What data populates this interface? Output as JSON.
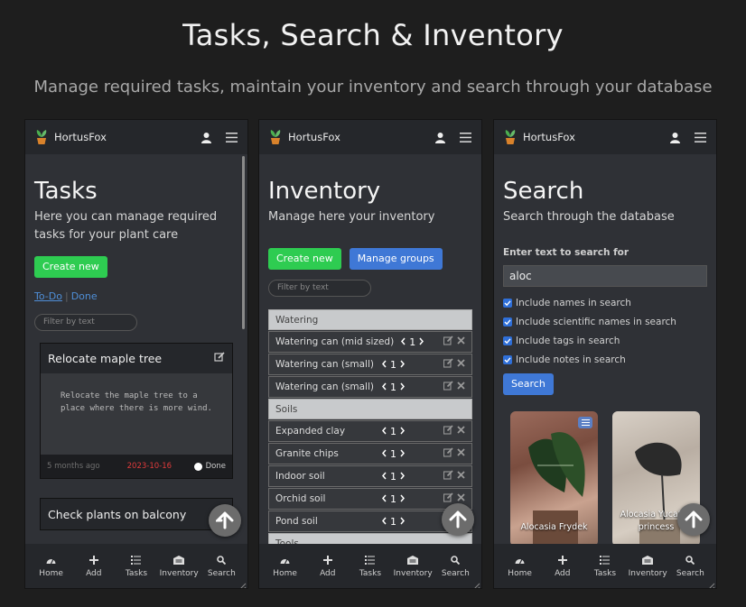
{
  "header": {
    "title": "Tasks, Search & Inventory",
    "subtitle": "Manage required tasks, maintain your inventory and search through your database"
  },
  "app": {
    "brand": "HortusFox",
    "accent": "#2ecc51",
    "link_color": "#4f8fd8"
  },
  "nav": [
    {
      "label": "Home",
      "icon": "dashboard-icon"
    },
    {
      "label": "Add",
      "icon": "plus-icon"
    },
    {
      "label": "Tasks",
      "icon": "list-icon"
    },
    {
      "label": "Inventory",
      "icon": "warehouse-icon"
    },
    {
      "label": "Search",
      "icon": "search-icon"
    }
  ],
  "tasks": {
    "title": "Tasks",
    "description": "Here you can manage required tasks for your plant care",
    "create_label": "Create new",
    "tab_todo": "To-Do",
    "tab_done": "Done",
    "filter_placeholder": "Filter by text",
    "cards": [
      {
        "title": "Relocate maple tree",
        "body": "Relocate the maple tree to a place where there is more wind.",
        "age": "5 months ago",
        "due": "2023-10-16",
        "done_label": "Done"
      },
      {
        "title": "Check plants on balcony"
      }
    ]
  },
  "inventory": {
    "title": "Inventory",
    "description": "Manage here your inventory",
    "create_label": "Create new",
    "groups_label": "Manage groups",
    "filter_placeholder": "Filter by text",
    "groups": [
      {
        "name": "Watering",
        "items": [
          {
            "name": "Watering can (mid sized)",
            "qty": "1"
          },
          {
            "name": "Watering can (small)",
            "qty": "1"
          },
          {
            "name": "Watering can (small)",
            "qty": "1"
          }
        ]
      },
      {
        "name": "Soils",
        "items": [
          {
            "name": "Expanded clay",
            "qty": "1"
          },
          {
            "name": "Granite chips",
            "qty": "1"
          },
          {
            "name": "Indoor soil",
            "qty": "1"
          },
          {
            "name": "Orchid soil",
            "qty": "1"
          },
          {
            "name": "Pond soil",
            "qty": "1"
          }
        ]
      },
      {
        "name": "Tools",
        "items": []
      }
    ]
  },
  "search": {
    "title": "Search",
    "description": "Search through the database",
    "input_label": "Enter text to search for",
    "input_value": "aloc",
    "options": [
      "Include names in search",
      "Include scientific names in search",
      "Include tags in search",
      "Include notes in search"
    ],
    "button_label": "Search",
    "results": [
      {
        "name": "Alocasia Frydek"
      },
      {
        "name": "Alocasia Yucatan princess"
      }
    ]
  }
}
